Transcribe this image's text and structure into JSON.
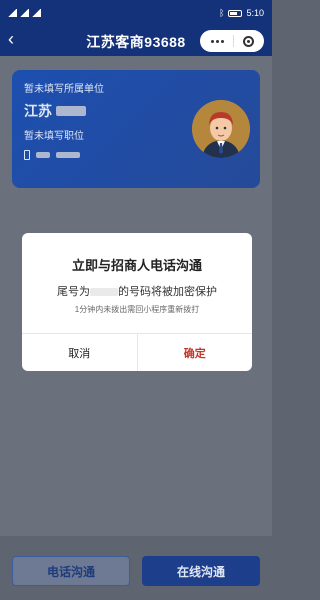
{
  "statusbar": {
    "time": "5:10"
  },
  "navbar": {
    "title": "江苏客商93688"
  },
  "card": {
    "line1": "暂未填写所属单位",
    "name_prefix": "江苏",
    "line3": "暂未填写职位"
  },
  "bottom": {
    "call_label": "电话沟通",
    "online_label": "在线沟通"
  },
  "modal": {
    "title": "立即与招商人电话沟通",
    "text_prefix": "尾号为",
    "text_suffix": "的号码将被加密保护",
    "hint": "1分钟内未拨出需回小程序重新拨打",
    "cancel_label": "取消",
    "ok_label": "确定"
  },
  "colors": {
    "nav_bg": "#14327a",
    "ok": "#c0392b"
  }
}
